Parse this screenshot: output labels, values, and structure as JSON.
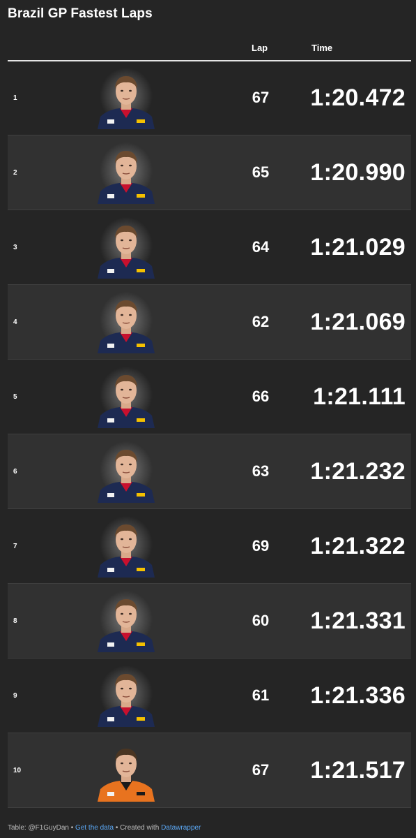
{
  "title": "Brazil GP Fastest Laps",
  "columns": {
    "lap": "Lap",
    "time": "Time"
  },
  "colors": {
    "background": "#252525",
    "row_alt": "#313131",
    "link": "#5ba8f5"
  },
  "rows": [
    {
      "rank": "1",
      "lap": "67",
      "time": "1:20.472",
      "driver_image": "driver-portrait-red-bull"
    },
    {
      "rank": "2",
      "lap": "65",
      "time": "1:20.990",
      "driver_image": "driver-portrait-red-bull"
    },
    {
      "rank": "3",
      "lap": "64",
      "time": "1:21.029",
      "driver_image": "driver-portrait-red-bull"
    },
    {
      "rank": "4",
      "lap": "62",
      "time": "1:21.069",
      "driver_image": "driver-portrait-red-bull"
    },
    {
      "rank": "5",
      "lap": "66",
      "time": "1:21.111",
      "driver_image": "driver-portrait-red-bull"
    },
    {
      "rank": "6",
      "lap": "63",
      "time": "1:21.232",
      "driver_image": "driver-portrait-red-bull"
    },
    {
      "rank": "7",
      "lap": "69",
      "time": "1:21.322",
      "driver_image": "driver-portrait-red-bull"
    },
    {
      "rank": "8",
      "lap": "60",
      "time": "1:21.331",
      "driver_image": "driver-portrait-red-bull"
    },
    {
      "rank": "9",
      "lap": "61",
      "time": "1:21.336",
      "driver_image": "driver-portrait-red-bull"
    },
    {
      "rank": "10",
      "lap": "67",
      "time": "1:21.517",
      "driver_image": "driver-portrait-mclaren"
    }
  ],
  "footer": {
    "prefix": "Table: @F1GuyDan • ",
    "get_data": "Get the data",
    "middle": " • Created with ",
    "datawrapper": "Datawrapper"
  }
}
